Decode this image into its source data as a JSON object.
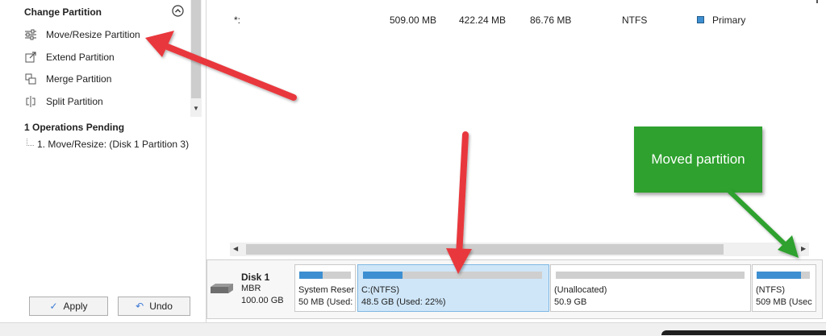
{
  "left_panel": {
    "change_partition_title": "Change Partition",
    "items": [
      {
        "label": "Move/Resize Partition",
        "icon": "sliders-icon"
      },
      {
        "label": "Extend Partition",
        "icon": "extend-icon"
      },
      {
        "label": "Merge Partition",
        "icon": "merge-icon"
      },
      {
        "label": "Split Partition",
        "icon": "split-icon"
      }
    ],
    "pending_title": "1 Operations Pending",
    "pending_items": [
      "1. Move/Resize: (Disk 1 Partition 3)"
    ],
    "apply_label": "Apply",
    "undo_label": "Undo"
  },
  "partition_row": {
    "name": "*:",
    "capacity": "509.00 MB",
    "used": "422.24 MB",
    "unused": "86.76 MB",
    "file_system": "NTFS",
    "type": "Primary",
    "type_color": "#3d8fd1"
  },
  "disk": {
    "name": "Disk 1",
    "style": "MBR",
    "size": "100.00 GB",
    "partitions": [
      {
        "name": "System Reser",
        "info": "50 MB (Used:",
        "used_fraction": 0.45
      },
      {
        "name": "C:(NTFS)",
        "info": "48.5 GB (Used: 22%)",
        "used_fraction": 0.22,
        "selected": true
      },
      {
        "name": "(Unallocated)",
        "info": "50.9 GB",
        "used_fraction": 0
      },
      {
        "name": "(NTFS)",
        "info": "509 MB (Usec",
        "used_fraction": 0.83
      }
    ]
  },
  "annotation": {
    "callout_text": "Moved partition",
    "callout_color": "#2ea12e",
    "arrow_color": "#e8383c"
  }
}
